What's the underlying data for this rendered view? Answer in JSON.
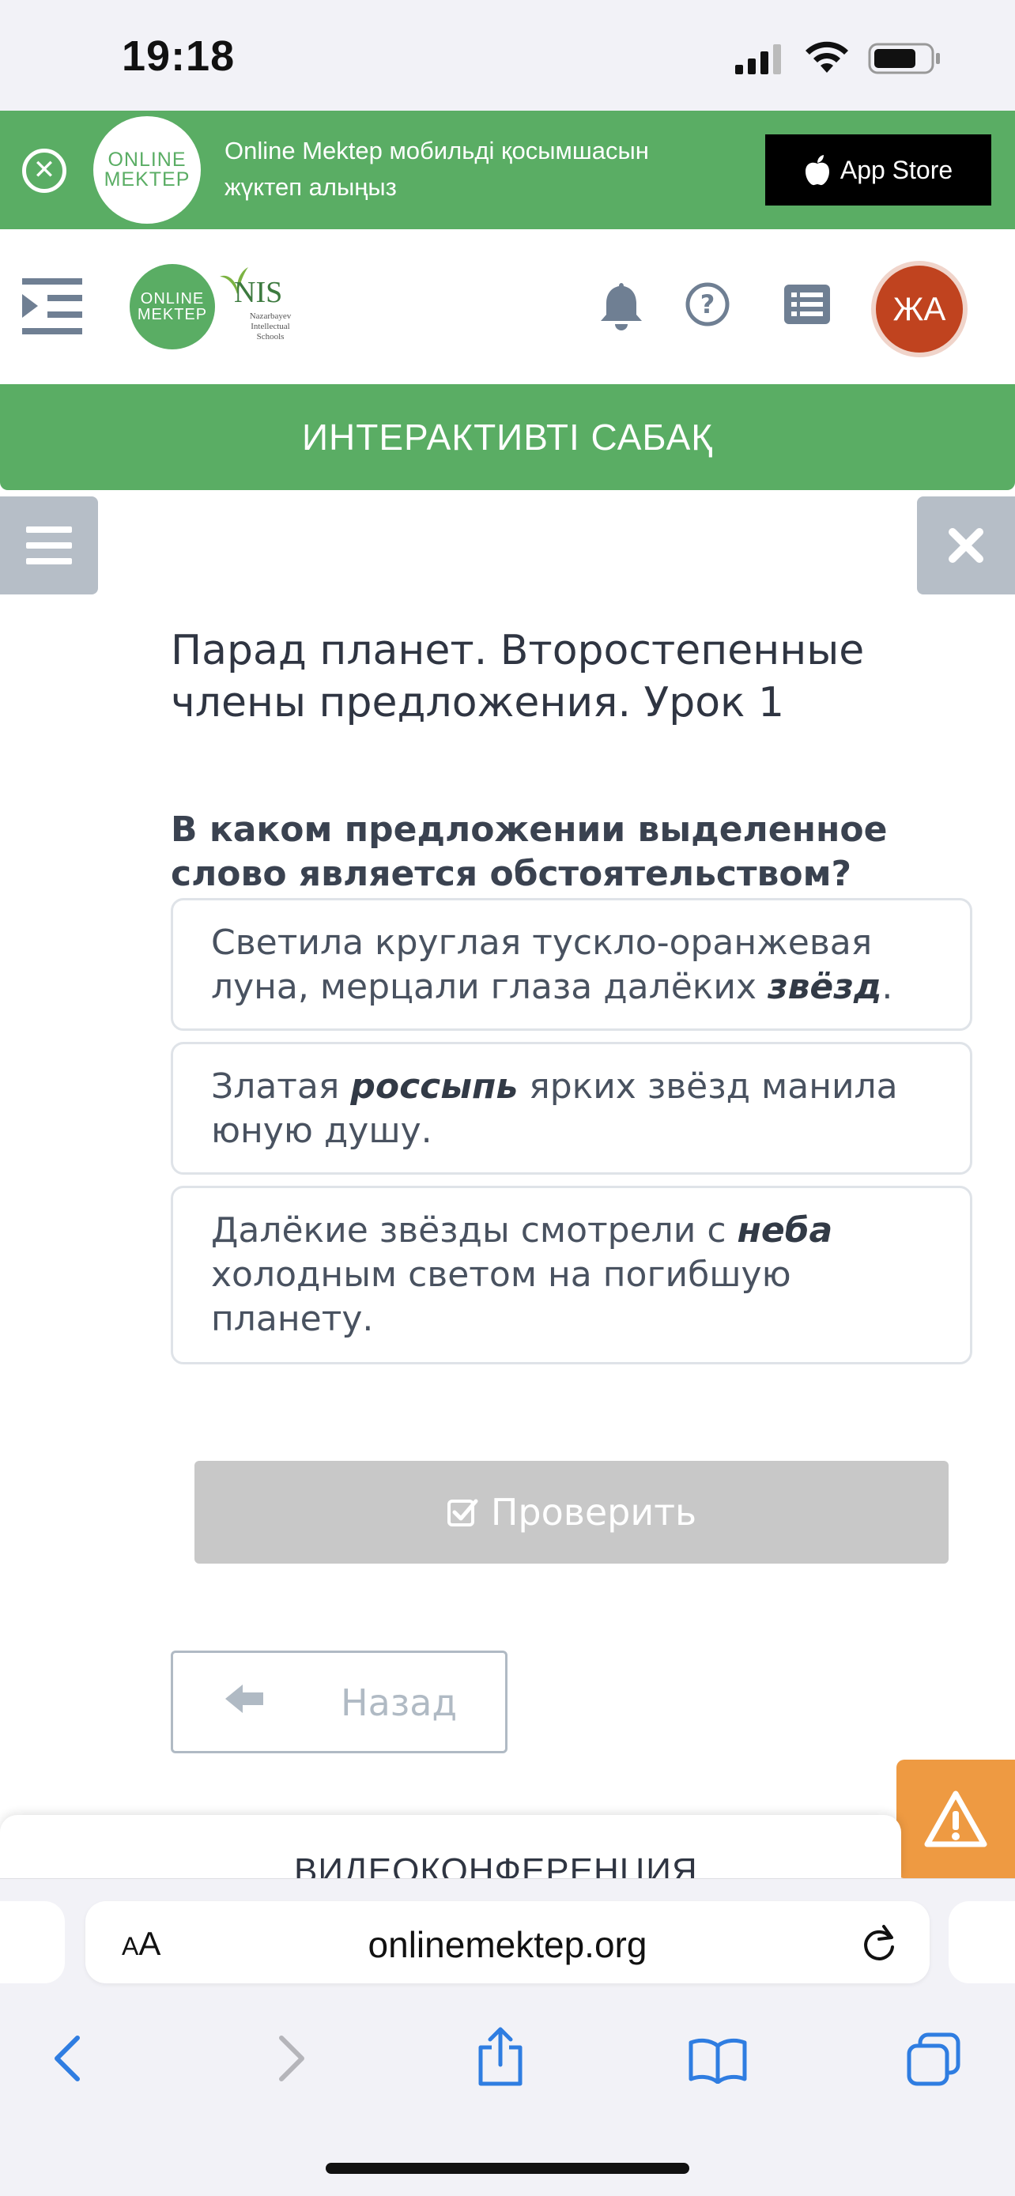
{
  "status_bar": {
    "time": "19:18"
  },
  "promo_banner": {
    "logo_line1": "ONLINE",
    "logo_line2": "MEKTEP",
    "text_line1": "Online Mektep мобильді қосымшасын",
    "text_line2": "жүктеп алыңыз",
    "app_store_label": "App Store"
  },
  "header": {
    "logo_line1": "ONLINE",
    "logo_line2": "MEKTEP",
    "nis_title": "NIS",
    "nis_subtitle_line1": "Nazarbayev",
    "nis_subtitle_line2": "Intellectual",
    "nis_subtitle_line3": "Schools",
    "avatar_initials": "ЖА"
  },
  "section_title": "ИНТЕРАКТИВТІ САБАҚ",
  "lesson": {
    "title": "Парад планет. Второстепенные члены предложения. Урок 1",
    "question": "В каком предложении выделенное слово является обстоятельством?",
    "options": [
      {
        "before": "Светила круглая тускло-оранжевая луна, мерцали глаза далёких ",
        "highlight": "звёзд",
        "after": "."
      },
      {
        "before": "Златая ",
        "highlight": "россыпь",
        "after": " ярких звёзд манила юную душу."
      },
      {
        "before": "Далёкие звёзды смотрели с ",
        "highlight": "неба",
        "after": " холодным светом на погибшую планету."
      }
    ],
    "check_label": "Проверить",
    "back_label": "Назад"
  },
  "video_conference_label": "ВИДЕОКОНФЕРЕНЦИЯ",
  "browser": {
    "aa_small": "A",
    "aa_large": "A",
    "url": "onlinemektep.org"
  },
  "colors": {
    "brand_green": "#5aad64",
    "avatar_bg": "#c0431f",
    "warning_orange": "#ee9a42",
    "disabled_gray": "#c8c8c8",
    "ios_blue": "#2f7de1"
  }
}
